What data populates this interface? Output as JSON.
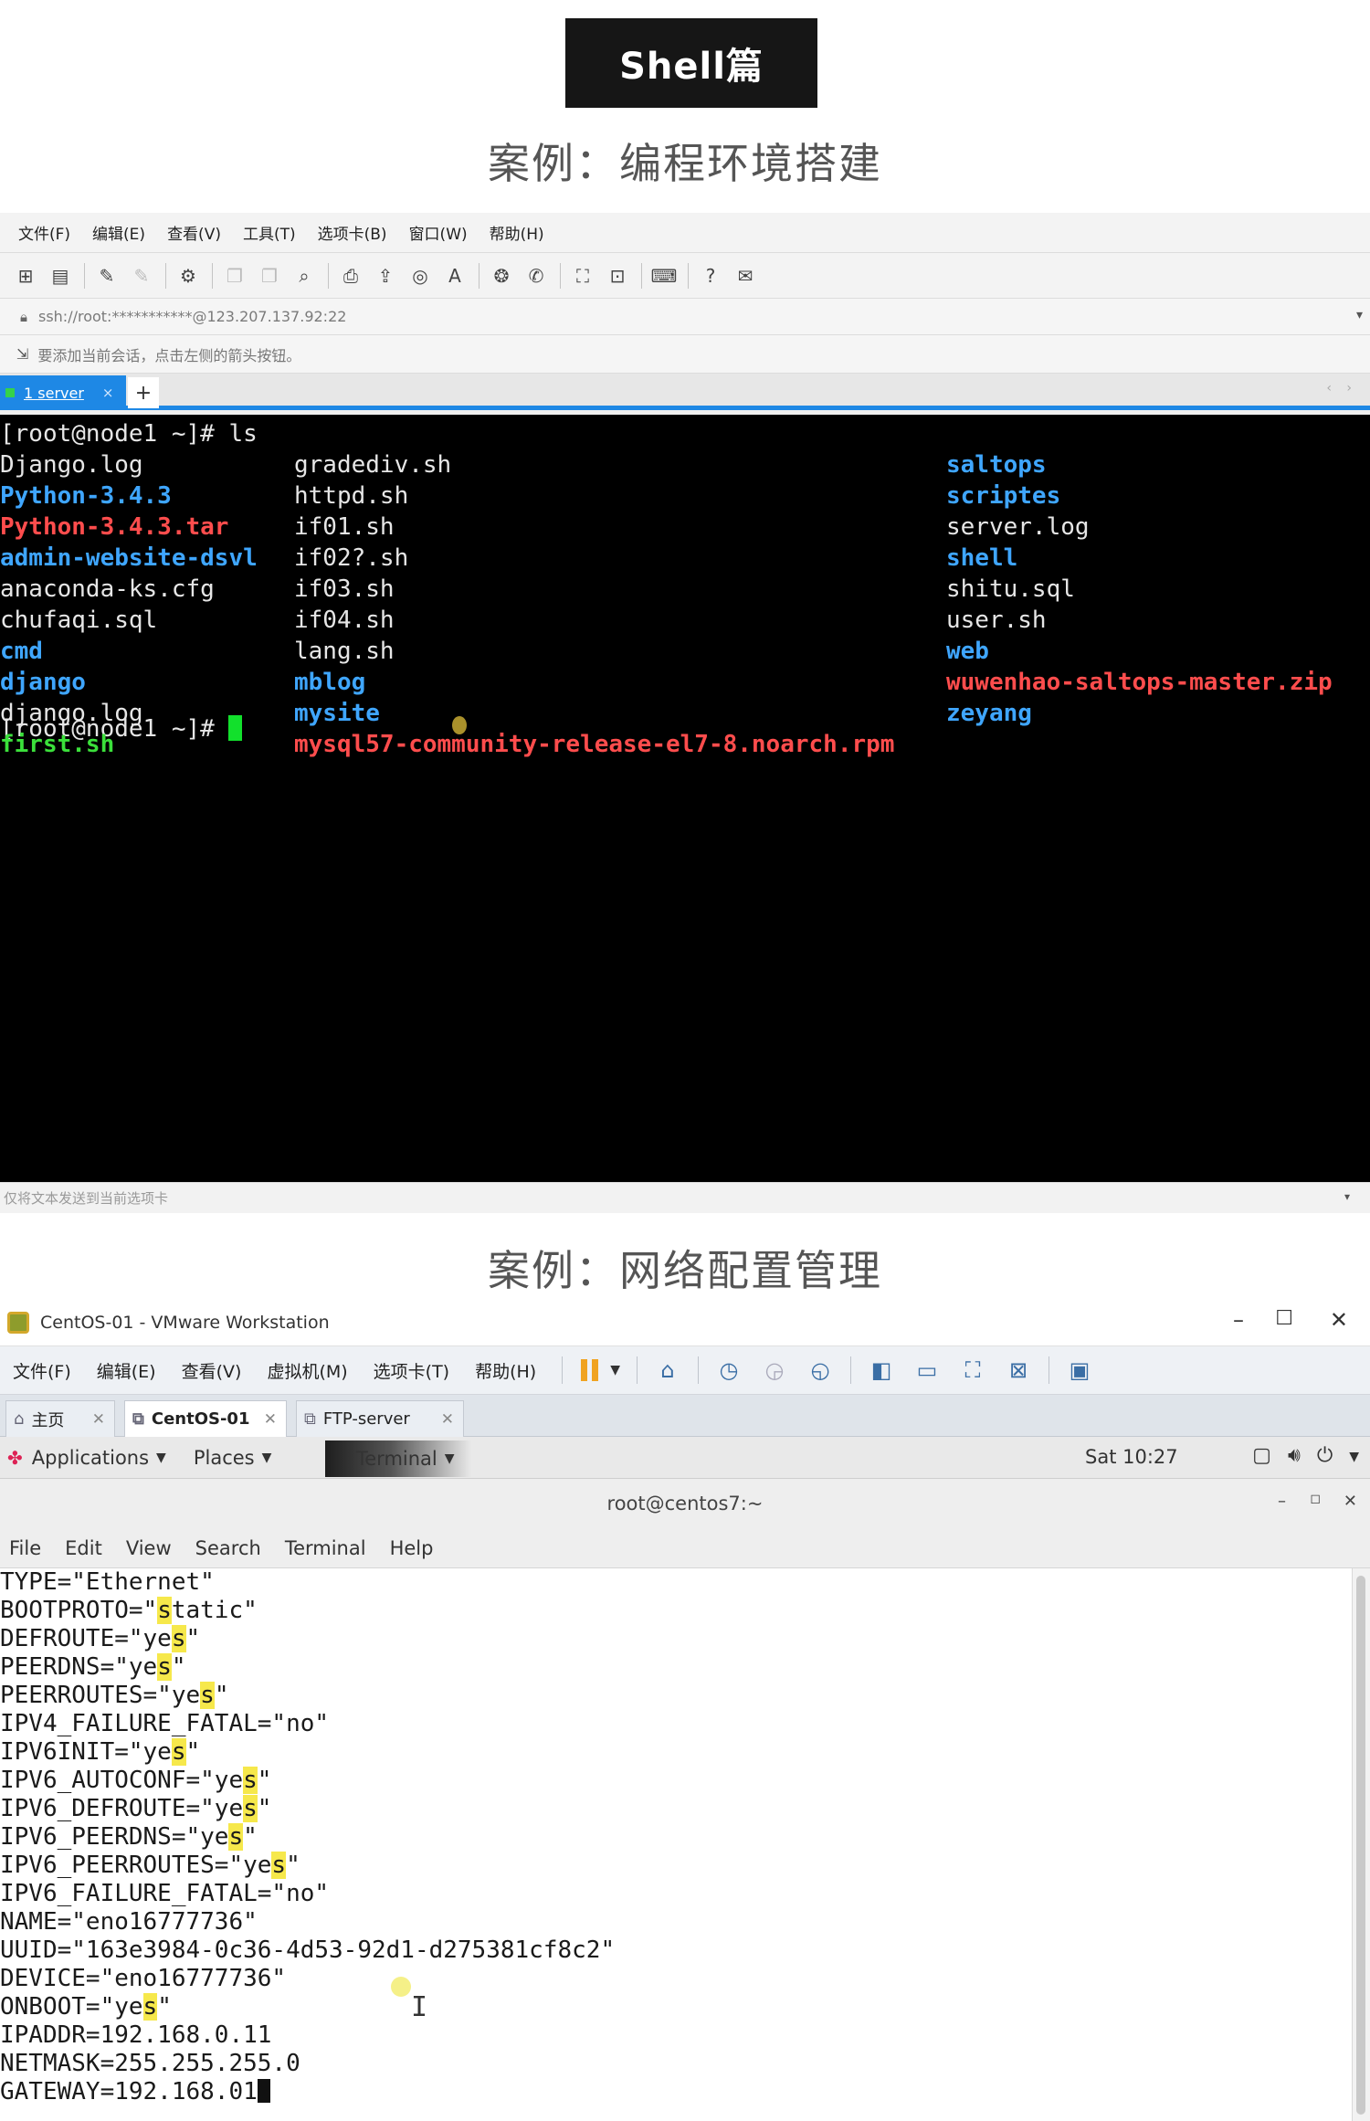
{
  "header": {
    "badge": "Shell篇",
    "section1_title": "案例：编程环境搭建",
    "section2_title": "案例：网络配置管理"
  },
  "xshell": {
    "menu": [
      "文件(F)",
      "编辑(E)",
      "查看(V)",
      "工具(T)",
      "选项卡(B)",
      "窗口(W)",
      "帮助(H)"
    ],
    "address": "ssh://root:***********@123.207.137.92:22",
    "hint": "要添加当前会话，点击左侧的箭头按钮。",
    "tab_label": "1 server",
    "tab_close": "×",
    "tab_add": "+",
    "status_text": "仅将文本发送到当前选项卡",
    "terminal": {
      "prompt_cmd": "[root@node1 ~]# ls",
      "prompt_end": "[root@node1 ~]# ",
      "col1": [
        {
          "text": "Django.log",
          "color": "white"
        },
        {
          "text": "Python-3.4.3",
          "color": "blue"
        },
        {
          "text": "Python-3.4.3.tar",
          "color": "red"
        },
        {
          "text": "admin-website-dsvl",
          "color": "blue"
        },
        {
          "text": "anaconda-ks.cfg",
          "color": "white"
        },
        {
          "text": "chufaqi.sql",
          "color": "white"
        },
        {
          "text": "cmd",
          "color": "blue"
        },
        {
          "text": "django",
          "color": "blue"
        },
        {
          "text": "django.log",
          "color": "white"
        },
        {
          "text": "first.sh",
          "color": "green"
        }
      ],
      "col2": [
        {
          "text": "gradediv.sh",
          "color": "white"
        },
        {
          "text": "httpd.sh",
          "color": "white"
        },
        {
          "text": "if01.sh",
          "color": "white"
        },
        {
          "text": "if02?.sh",
          "color": "white"
        },
        {
          "text": "if03.sh",
          "color": "white"
        },
        {
          "text": "if04.sh",
          "color": "white"
        },
        {
          "text": "lang.sh",
          "color": "white"
        },
        {
          "text": "mblog",
          "color": "blue"
        },
        {
          "text": "mysite",
          "color": "blue"
        },
        {
          "text": "mysql57-community-release-el7-8.noarch.rpm",
          "color": "red"
        }
      ],
      "col3": [
        {
          "text": "saltops",
          "color": "blue"
        },
        {
          "text": "scriptes",
          "color": "blue"
        },
        {
          "text": "server.log",
          "color": "white"
        },
        {
          "text": "shell",
          "color": "blue"
        },
        {
          "text": "shitu.sql",
          "color": "white"
        },
        {
          "text": "user.sh",
          "color": "white"
        },
        {
          "text": "web",
          "color": "blue"
        },
        {
          "text": "wuwenhao-saltops-master.zip",
          "color": "red"
        },
        {
          "text": "zeyang",
          "color": "blue"
        }
      ]
    }
  },
  "vmware": {
    "title": "CentOS-01 - VMware Workstation",
    "menu": [
      "文件(F)",
      "编辑(E)",
      "查看(V)",
      "虚拟机(M)",
      "选项卡(T)",
      "帮助(H)"
    ],
    "tabs": [
      "主页",
      "CentOS-01",
      "FTP-server"
    ],
    "gnome": {
      "applications": "Applications",
      "places": "Places",
      "terminal": "Terminal",
      "clock": "Sat 10:27"
    },
    "terminal_title": "root@centos7:~",
    "terminal_menu": [
      "File",
      "Edit",
      "View",
      "Search",
      "Terminal",
      "Help"
    ],
    "config_lines": [
      {
        "before": "TYPE=\"Ethernet\"",
        "hl": "",
        "after": ""
      },
      {
        "before": "BOOTPROTO=\"",
        "hl": "s",
        "after": "tatic\""
      },
      {
        "before": "DEFROUTE=\"ye",
        "hl": "s",
        "after": "\""
      },
      {
        "before": "PEERDNS=\"ye",
        "hl": "s",
        "after": "\""
      },
      {
        "before": "PEERROUTES=\"ye",
        "hl": "s",
        "after": "\""
      },
      {
        "before": "IPV4_FAILURE_FATAL=\"no\"",
        "hl": "",
        "after": ""
      },
      {
        "before": "IPV6INIT=\"ye",
        "hl": "s",
        "after": "\""
      },
      {
        "before": "IPV6_AUTOCONF=\"ye",
        "hl": "s",
        "after": "\""
      },
      {
        "before": "IPV6_DEFROUTE=\"ye",
        "hl": "s",
        "after": "\""
      },
      {
        "before": "IPV6_PEERDNS=\"ye",
        "hl": "s",
        "after": "\""
      },
      {
        "before": "IPV6_PEERROUTES=\"ye",
        "hl": "s",
        "after": "\""
      },
      {
        "before": "IPV6_FAILURE_FATAL=\"no\"",
        "hl": "",
        "after": ""
      },
      {
        "before": "NAME=\"eno16777736\"",
        "hl": "",
        "after": ""
      },
      {
        "before": "UUID=\"163e3984-0c36-4d53-92d1-d275381cf8c2\"",
        "hl": "",
        "after": ""
      },
      {
        "before": "DEVICE=\"eno16777736\"",
        "hl": "",
        "after": ""
      },
      {
        "before": "ONBOOT=\"ye",
        "hl": "s",
        "after": "\""
      },
      {
        "before": "IPADDR=192.168.0.11",
        "hl": "",
        "after": ""
      },
      {
        "before": "NETMASK=255.255.255.0",
        "hl": "",
        "after": ""
      },
      {
        "before": "GATEWAY=192.168.01",
        "hl": "",
        "after": ""
      }
    ]
  }
}
